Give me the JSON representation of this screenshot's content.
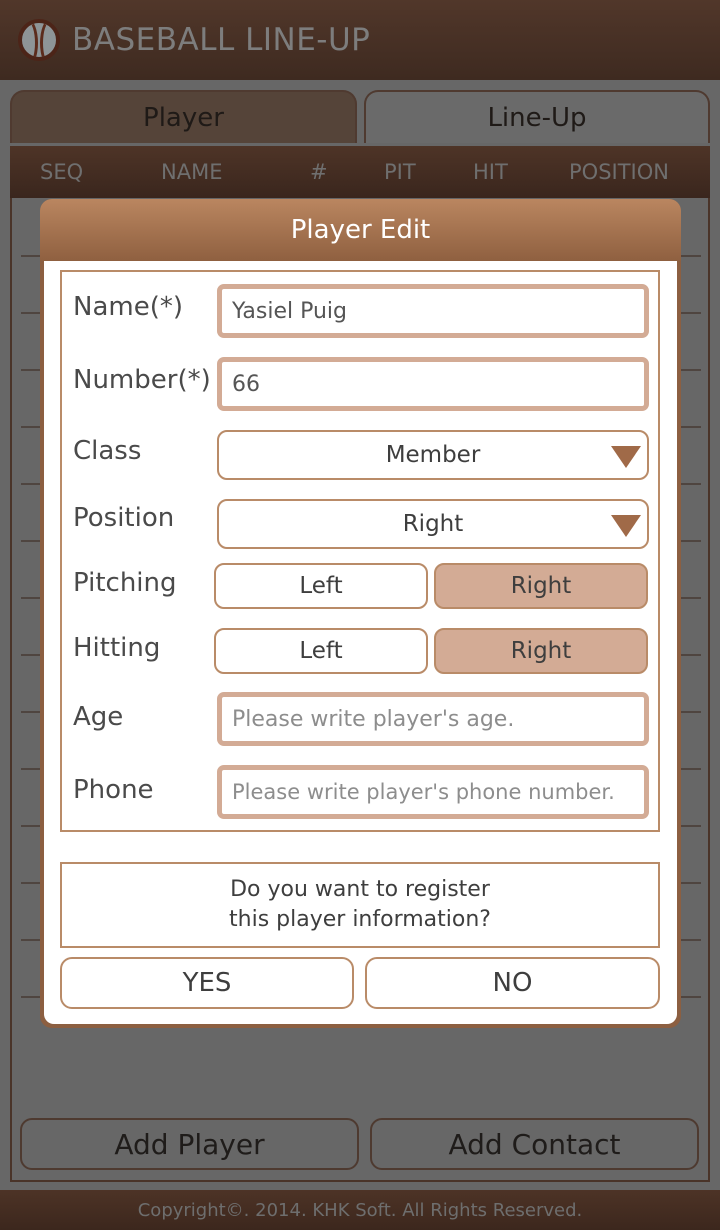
{
  "app": {
    "title": "BASEBALL LINE-UP",
    "logo_icon": "baseball-icon"
  },
  "tabs": [
    {
      "label": "Player",
      "active": true
    },
    {
      "label": "Line-Up",
      "active": false
    }
  ],
  "table": {
    "columns": [
      "SEQ",
      "NAME",
      "#",
      "PIT",
      "HIT",
      "POSITION"
    ]
  },
  "bottom_buttons": {
    "add_player": "Add Player",
    "add_contact": "Add Contact"
  },
  "footer": {
    "copyright": "Copyright©. 2014. KHK Soft. All Rights Reserved."
  },
  "dialog": {
    "title": "Player Edit",
    "fields": {
      "name": {
        "label": "Name(*)",
        "value": "Yasiel Puig"
      },
      "number": {
        "label": "Number(*)",
        "value": "66"
      },
      "class": {
        "label": "Class",
        "selected": "Member"
      },
      "position": {
        "label": "Position",
        "selected": "Right"
      },
      "pitching": {
        "label": "Pitching",
        "options": [
          "Left",
          "Right"
        ],
        "selected": "Right"
      },
      "hitting": {
        "label": "Hitting",
        "options": [
          "Left",
          "Right"
        ],
        "selected": "Right"
      },
      "age": {
        "label": "Age",
        "value": "",
        "placeholder": "Please write player's age."
      },
      "phone": {
        "label": "Phone",
        "value": "",
        "placeholder": "Please write player's phone number."
      }
    },
    "confirm": {
      "line1": "Do you want to register",
      "line2": "this player information?"
    },
    "yes_label": "YES",
    "no_label": "NO"
  },
  "colors": {
    "header_brown": "#4e3427",
    "dialog_title": "#ba8660",
    "accent_border": "#b98b68",
    "selected_fill": "#d3ab95",
    "overlay_gray": "#676767"
  }
}
